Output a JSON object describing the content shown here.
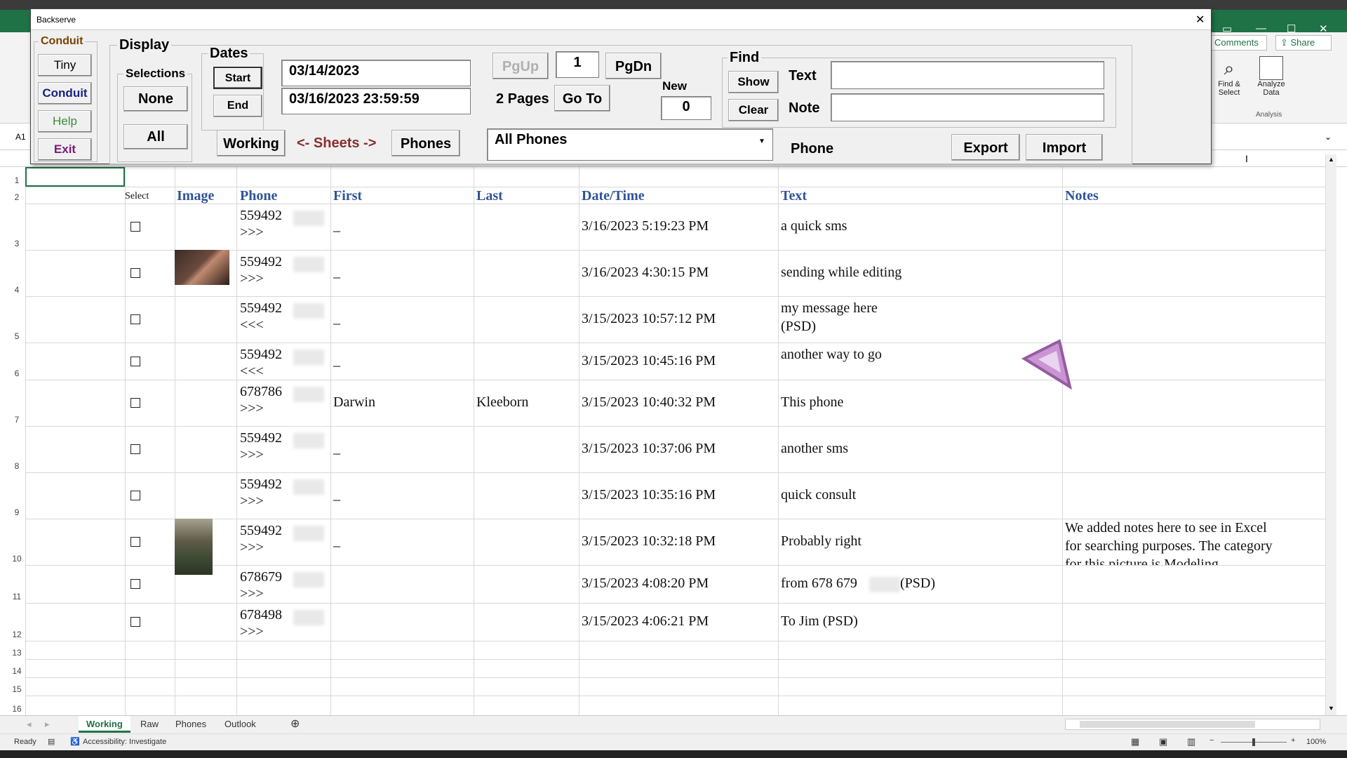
{
  "excel": {
    "ribbon": {
      "comments_label": "Comments",
      "share_label": "Share",
      "find_select_label": "Find & Select",
      "analyze_data_label": "Analyze Data",
      "analysis_group": "Analysis"
    },
    "name_box": "A1",
    "columns": {
      "select": "Select",
      "image": "Image",
      "phone": "Phone",
      "first": "First",
      "last": "Last",
      "datetime": "Date/Time",
      "text": "Text",
      "notes": "Notes"
    },
    "row_numbers": [
      "1",
      "2",
      "3",
      "4",
      "5",
      "6",
      "7",
      "8",
      "9",
      "10",
      "11",
      "12",
      "13",
      "14",
      "15",
      "16"
    ],
    "rows": [
      {
        "phone": "559492",
        "dir": ">>>",
        "first": "_",
        "last": "",
        "datetime": "3/16/2023 5:19:23 PM",
        "text1": "a quick sms",
        "text2": "",
        "note1": "",
        "note2": "",
        "note3": ""
      },
      {
        "phone": "559492",
        "dir": ">>>",
        "first": "_",
        "last": "",
        "datetime": "3/16/2023 4:30:15 PM",
        "text1": "sending while editing",
        "text2": "",
        "note1": "",
        "note2": "",
        "note3": ""
      },
      {
        "phone": "559492",
        "dir": "<<<",
        "first": "_",
        "last": "",
        "datetime": "3/15/2023 10:57:12 PM",
        "text1": "my message here",
        "text2": "(PSD)",
        "note1": "",
        "note2": "",
        "note3": ""
      },
      {
        "phone": "559492",
        "dir": "<<<",
        "first": "_",
        "last": "",
        "datetime": "3/15/2023 10:45:16 PM",
        "text1": "another way to go",
        "text2": "",
        "note1": "",
        "note2": "",
        "note3": ""
      },
      {
        "phone": "678786",
        "dir": ">>>",
        "first": "Darwin",
        "last": "Kleeborn",
        "datetime": "3/15/2023 10:40:32 PM",
        "text1": "This phone",
        "text2": "",
        "note1": "",
        "note2": "",
        "note3": ""
      },
      {
        "phone": "559492",
        "dir": ">>>",
        "first": "_",
        "last": "",
        "datetime": "3/15/2023 10:37:06 PM",
        "text1": "another sms",
        "text2": "",
        "note1": "",
        "note2": "",
        "note3": ""
      },
      {
        "phone": "559492",
        "dir": ">>>",
        "first": "_",
        "last": "",
        "datetime": "3/15/2023 10:35:16 PM",
        "text1": "quick consult",
        "text2": "",
        "note1": "",
        "note2": "",
        "note3": ""
      },
      {
        "phone": "559492",
        "dir": ">>>",
        "first": "_",
        "last": "",
        "datetime": "3/15/2023 10:32:18 PM",
        "text1": "Probably right",
        "text2": "",
        "note1": "We added notes here to see in Excel",
        "note2": "for searching purposes. The category",
        "note3": "for this picture is Modeling"
      },
      {
        "phone": "678679",
        "dir": ">>>",
        "first": "",
        "last": "",
        "datetime": "3/15/2023 4:08:20 PM",
        "text1": "from 678 679",
        "text2": "(PSD)",
        "note1": "",
        "note2": "",
        "note3": ""
      },
      {
        "phone": "678498",
        "dir": ">>>",
        "first": "",
        "last": "",
        "datetime": "3/15/2023 4:06:21 PM",
        "text1": "To Jim (PSD)",
        "text2": "",
        "note1": "",
        "note2": "",
        "note3": ""
      }
    ],
    "sheet_tabs": [
      "Working",
      "Raw",
      "Phones",
      "Outlook"
    ],
    "status": {
      "ready": "Ready",
      "accessibility": "Accessibility: Investigate",
      "zoom": "100%"
    }
  },
  "dialog": {
    "title": "Backserve",
    "close_glyph": "✕",
    "conduit_group": "Conduit",
    "buttons": {
      "tiny": "Tiny",
      "conduit": "Conduit",
      "help": "Help",
      "exit": "Exit",
      "none": "None",
      "all": "All",
      "start": "Start",
      "end": "End",
      "working": "Working",
      "phones": "Phones",
      "pgup": "PgUp",
      "pgdn": "PgDn",
      "goto": "Go To",
      "show": "Show",
      "clear": "Clear",
      "export": "Export",
      "import": "Import"
    },
    "display_group": "Display",
    "selections_group": "Selections",
    "dates_group": "Dates",
    "start_date": "03/14/2023",
    "end_date": "03/16/2023 23:59:59",
    "sheets_label": "<- Sheets ->",
    "page_number": "1",
    "pages_label": "2 Pages",
    "new_label": "New",
    "new_count": "0",
    "phone_select_value": "All Phones",
    "phone_label": "Phone",
    "find_group": "Find",
    "text_label": "Text",
    "note_label": "Note",
    "text_value": "",
    "note_value": ""
  },
  "colors": {
    "excel_green": "#1f7246",
    "header_blue": "#2f5597",
    "conduit_brown": "#7b3f00",
    "conduit_navy": "#1a237e",
    "help_green": "#3a8c3a",
    "exit_purple": "#7a1a7a",
    "sheets_red": "#8b2e2e"
  }
}
